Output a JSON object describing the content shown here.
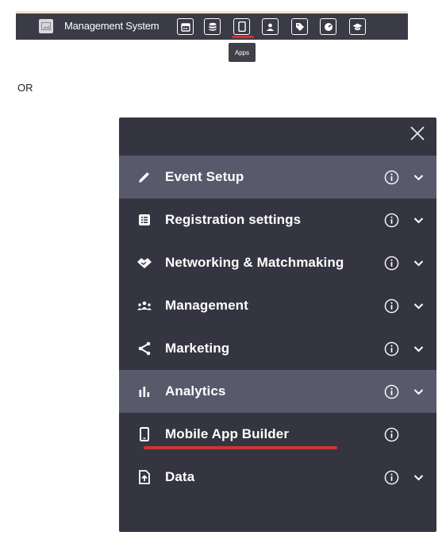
{
  "toolbar": {
    "title": "Management System",
    "buttons": [
      {
        "icon": "calendar-icon"
      },
      {
        "icon": "database-icon"
      },
      {
        "icon": "mobile-icon"
      },
      {
        "icon": "users-icon"
      },
      {
        "icon": "tag-icon"
      },
      {
        "icon": "gauge-icon"
      },
      {
        "icon": "graduation-cap-icon"
      }
    ],
    "tooltip": "Apps"
  },
  "separator_text": "OR",
  "menu": {
    "items": [
      {
        "label": "Event Setup",
        "icon": "pencil-icon",
        "highlighted": true,
        "expandable": true
      },
      {
        "label": "Registration settings",
        "icon": "list-icon",
        "highlighted": false,
        "expandable": true
      },
      {
        "label": "Networking & Matchmaking",
        "icon": "handshake-icon",
        "highlighted": false,
        "expandable": true
      },
      {
        "label": "Management",
        "icon": "people-icon",
        "highlighted": false,
        "expandable": true
      },
      {
        "label": "Marketing",
        "icon": "share-icon",
        "highlighted": false,
        "expandable": true
      },
      {
        "label": "Analytics",
        "icon": "bar-chart-icon",
        "highlighted": true,
        "expandable": true
      },
      {
        "label": "Mobile App Builder",
        "icon": "mobile-icon",
        "highlighted": false,
        "expandable": false
      },
      {
        "label": "Data",
        "icon": "upload-file-icon",
        "highlighted": false,
        "expandable": true
      }
    ]
  },
  "colors": {
    "topbar": "#3a3b47",
    "panel": "#343540",
    "highlight": "#585a6b",
    "accent_red": "#d0342c"
  }
}
